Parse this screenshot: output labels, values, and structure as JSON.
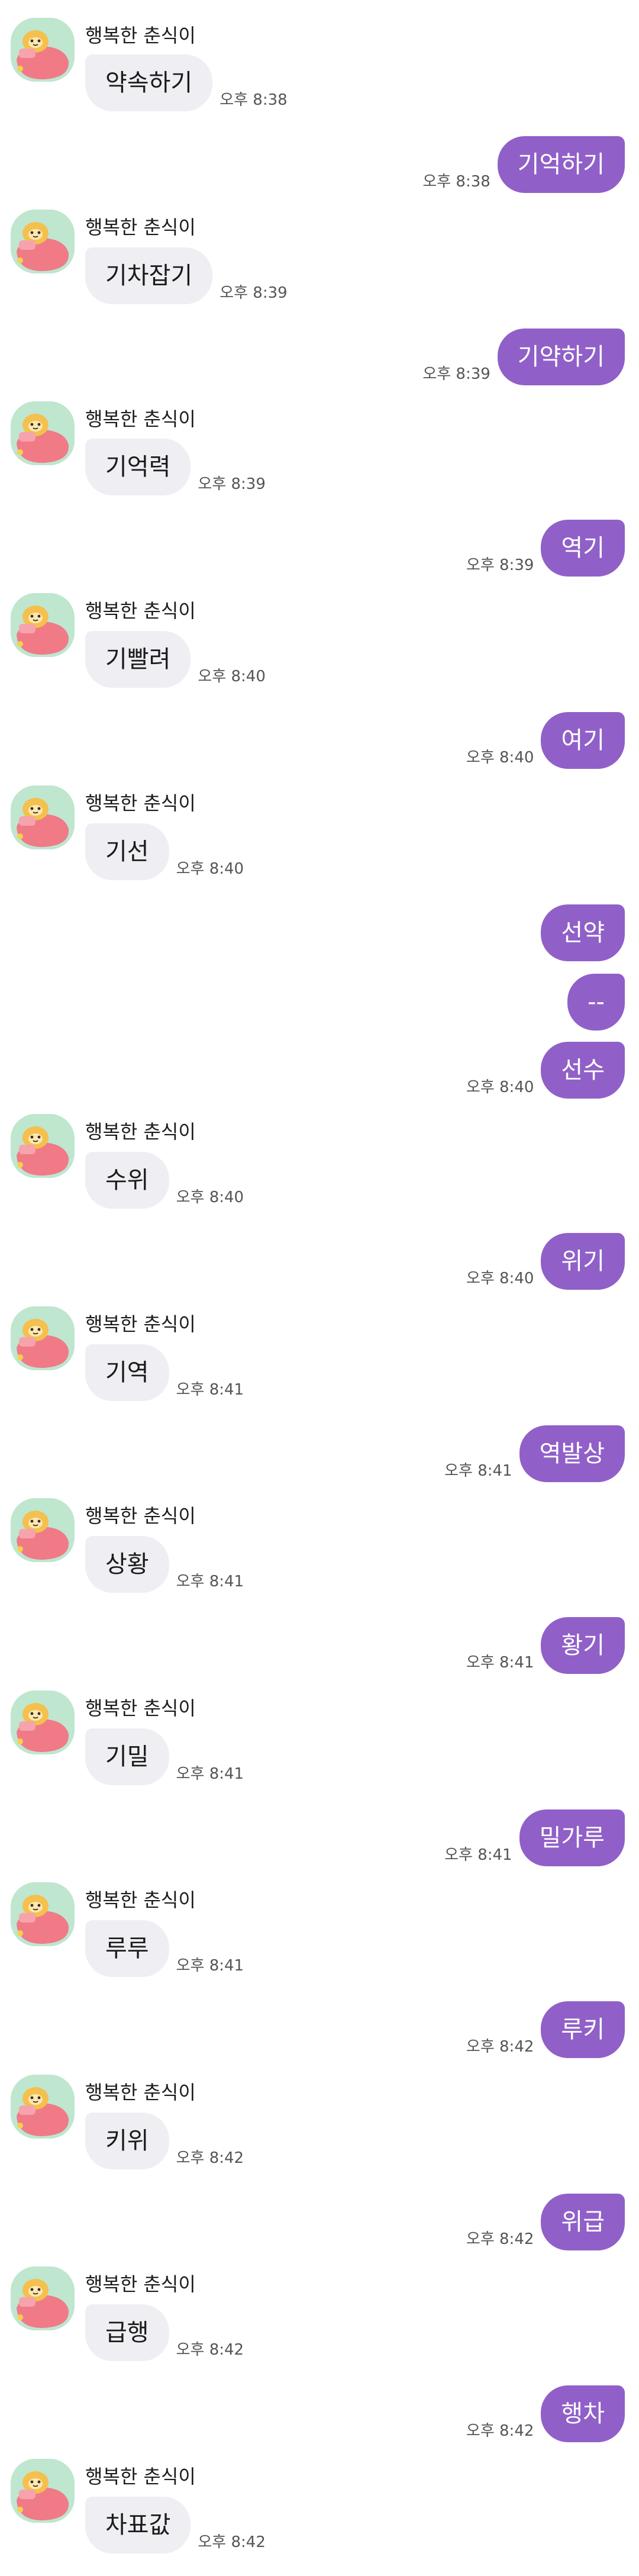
{
  "sender_name": "행복한 춘식이",
  "colors": {
    "incoming_bubble": "#efeef3",
    "outgoing_bubble": "#9060c8",
    "avatar_bg": "#bfe6cf"
  },
  "messages": [
    {
      "dir": "in",
      "text": "약속하기",
      "time": "오후 8:38"
    },
    {
      "dir": "out",
      "text": "기억하기",
      "time": "오후 8:38"
    },
    {
      "dir": "in",
      "text": "기차잡기",
      "time": "오후 8:39"
    },
    {
      "dir": "out",
      "text": "기약하기",
      "time": "오후 8:39"
    },
    {
      "dir": "in",
      "text": "기억력",
      "time": "오후 8:39"
    },
    {
      "dir": "out",
      "text": "역기",
      "time": "오후 8:39"
    },
    {
      "dir": "in",
      "text": "기빨려",
      "time": "오후 8:40"
    },
    {
      "dir": "out",
      "text": "여기",
      "time": "오후 8:40"
    },
    {
      "dir": "in",
      "text": "기선",
      "time": "오후 8:40"
    },
    {
      "dir": "out",
      "text": "선약",
      "time": ""
    },
    {
      "dir": "out",
      "text": "--",
      "time": ""
    },
    {
      "dir": "out",
      "text": "선수",
      "time": "오후 8:40"
    },
    {
      "dir": "in",
      "text": "수위",
      "time": "오후 8:40"
    },
    {
      "dir": "out",
      "text": "위기",
      "time": "오후 8:40"
    },
    {
      "dir": "in",
      "text": "기역",
      "time": "오후 8:41"
    },
    {
      "dir": "out",
      "text": "역발상",
      "time": "오후 8:41"
    },
    {
      "dir": "in",
      "text": "상황",
      "time": "오후 8:41"
    },
    {
      "dir": "out",
      "text": "황기",
      "time": "오후 8:41"
    },
    {
      "dir": "in",
      "text": "기밀",
      "time": "오후 8:41"
    },
    {
      "dir": "out",
      "text": "밀가루",
      "time": "오후 8:41"
    },
    {
      "dir": "in",
      "text": "루루",
      "time": "오후 8:41"
    },
    {
      "dir": "out",
      "text": "루키",
      "time": "오후 8:42"
    },
    {
      "dir": "in",
      "text": "키위",
      "time": "오후 8:42"
    },
    {
      "dir": "out",
      "text": "위급",
      "time": "오후 8:42"
    },
    {
      "dir": "in",
      "text": "급행",
      "time": "오후 8:42"
    },
    {
      "dir": "out",
      "text": "행차",
      "time": "오후 8:42"
    },
    {
      "dir": "in",
      "text": "차표값",
      "time": "오후 8:42"
    }
  ]
}
